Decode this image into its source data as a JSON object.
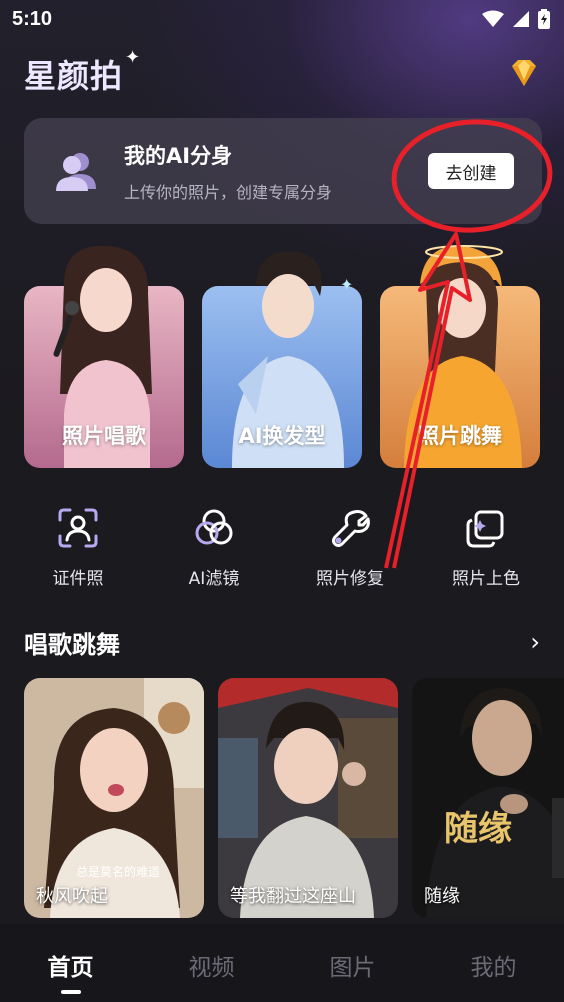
{
  "status": {
    "time": "5:10"
  },
  "header": {
    "title": "星颜拍",
    "sparkle": "✦"
  },
  "ai_card": {
    "title": "我的AI分身",
    "subtitle": "上传你的照片，创建专属分身",
    "button": "去创建"
  },
  "features": [
    {
      "label": "照片唱歌"
    },
    {
      "label": "AI换发型"
    },
    {
      "label": "照片跳舞"
    }
  ],
  "tools": [
    {
      "label": "证件照",
      "icon": "id-photo-icon"
    },
    {
      "label": "AI滤镜",
      "icon": "filter-icon"
    },
    {
      "label": "照片修复",
      "icon": "wrench-icon"
    },
    {
      "label": "照片上色",
      "icon": "colorize-icon"
    }
  ],
  "section": {
    "title": "唱歌跳舞",
    "more": "›"
  },
  "videos": [
    {
      "title": "秋风吹起",
      "caption": "总是莫名的难道"
    },
    {
      "title": "等我翻过这座山",
      "caption": ""
    },
    {
      "title": "随缘",
      "poster_text": "随缘"
    }
  ],
  "nav": {
    "items": [
      "首页",
      "视频",
      "图片",
      "我的"
    ],
    "active": 0
  },
  "colors": {
    "accent": "#e8202a",
    "background": "#1b1a1f"
  }
}
